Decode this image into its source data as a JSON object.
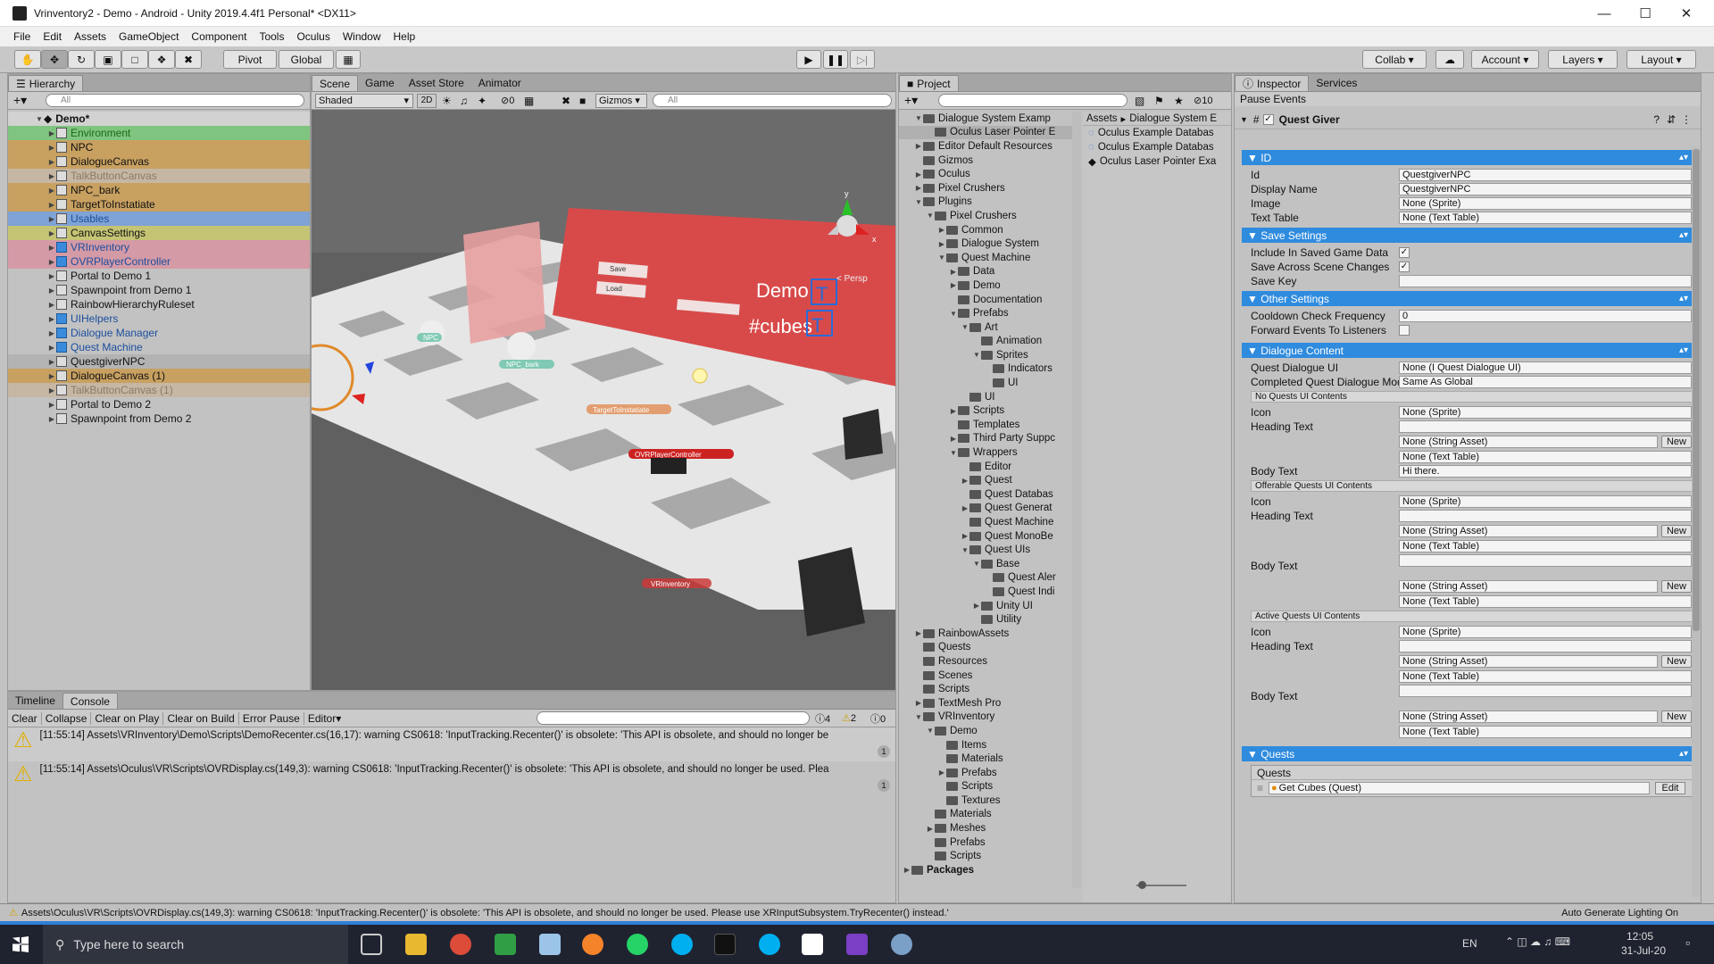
{
  "window": {
    "title": "Vrinventory2 - Demo - Android - Unity 2019.4.4f1 Personal* <DX11>"
  },
  "menu": [
    "File",
    "Edit",
    "Assets",
    "GameObject",
    "Component",
    "Tools",
    "Oculus",
    "Window",
    "Help"
  ],
  "toolbar": {
    "pivot": "Pivot",
    "global": "Global",
    "collab": "Collab",
    "account": "Account",
    "layers": "Layers",
    "layout": "Layout"
  },
  "hierarchy": {
    "tab": "Hierarchy",
    "search_placeholder": "All",
    "scene": "Demo*",
    "items": [
      {
        "label": "Environment",
        "color": "#1a6b1a",
        "bg": "#7fc47f",
        "icon": "gray"
      },
      {
        "label": "NPC",
        "color": "#111",
        "bg": "#c8a060",
        "icon": "gray"
      },
      {
        "label": "DialogueCanvas",
        "color": "#111",
        "bg": "#c8a060",
        "icon": "gray"
      },
      {
        "label": "TalkButtonCanvas",
        "color": "#8a7a66",
        "bg": "#c6b7a4",
        "icon": "gray"
      },
      {
        "label": "NPC_bark",
        "color": "#111",
        "bg": "#c8a060",
        "icon": "gray"
      },
      {
        "label": "TargetToInstatiate",
        "color": "#111",
        "bg": "#c8a060",
        "icon": "gray"
      },
      {
        "label": "Usables",
        "color": "#1c4e9e",
        "bg": "#7fa3d6",
        "icon": "gray"
      },
      {
        "label": "CanvasSettings",
        "color": "#111",
        "bg": "#c4c474",
        "icon": "gray"
      },
      {
        "label": "VRInventory",
        "color": "#1c4e9e",
        "bg": "#d49aa6",
        "icon": "blue"
      },
      {
        "label": "OVRPlayerController",
        "color": "#1c4e9e",
        "bg": "#d49aa6",
        "icon": "blue"
      },
      {
        "label": "Portal to Demo 1",
        "color": "#111",
        "bg": "",
        "icon": "gray"
      },
      {
        "label": "Spawnpoint from Demo 1",
        "color": "#111",
        "bg": "",
        "icon": "gray"
      },
      {
        "label": "RainbowHierarchyRuleset",
        "color": "#111",
        "bg": "",
        "icon": "gray"
      },
      {
        "label": "UIHelpers",
        "color": "#1c4e9e",
        "bg": "",
        "icon": "blue"
      },
      {
        "label": "Dialogue Manager",
        "color": "#1c4e9e",
        "bg": "",
        "icon": "blue"
      },
      {
        "label": "Quest Machine",
        "color": "#1c4e9e",
        "bg": "",
        "icon": "blue"
      },
      {
        "label": "QuestgiverNPC",
        "color": "#111",
        "bg": "#c8a060",
        "icon": "gray"
      },
      {
        "label": "DialogueCanvas (1)",
        "color": "#111",
        "bg": "#c8a060",
        "icon": "gray"
      },
      {
        "label": "TalkButtonCanvas (1)",
        "color": "#8a7a66",
        "bg": "#c6b7a4",
        "icon": "gray"
      },
      {
        "label": "Portal to Demo 2",
        "color": "#111",
        "bg": "",
        "icon": "gray"
      },
      {
        "label": "Spawnpoint from Demo 2",
        "color": "#111",
        "bg": "",
        "icon": "gray"
      }
    ]
  },
  "scene": {
    "tabs": [
      "Scene",
      "Game",
      "Asset Store",
      "Animator"
    ],
    "shading": "Shaded",
    "mode2d": "2D",
    "gizmos": "Gizmos",
    "search_placeholder": "All",
    "persp": "< Persp",
    "hidden_count": "0",
    "labels": {
      "npc": "NPC",
      "npc_bark": "NPC_bark",
      "target": "TargetToInstatiate",
      "ovr": "OVRPlayerController",
      "vrinv": "VRInventory",
      "demo": "Demo",
      "cubes": "#cubes",
      "t1": "T",
      "t2": "T",
      "save": "Save",
      "load": "Load"
    }
  },
  "console": {
    "tabs": [
      "Timeline",
      "Console"
    ],
    "buttons": [
      "Clear",
      "Collapse",
      "Clear on Play",
      "Clear on Build",
      "Error Pause",
      "Editor"
    ],
    "counts": {
      "info": "4",
      "warn": "2",
      "err": "0"
    },
    "messages": [
      {
        "text": "[11:55:14] Assets\\VRInventory\\Demo\\Scripts\\DemoRecenter.cs(16,17): warning CS0618: 'InputTracking.Recenter()' is obsolete: 'This API is obsolete, and should no longer be",
        "count": "1"
      },
      {
        "text": "[11:55:14] Assets\\Oculus\\VR\\Scripts\\OVRDisplay.cs(149,3): warning CS0618: 'InputTracking.Recenter()' is obsolete: 'This API is obsolete, and should no longer be used. Plea",
        "count": "1"
      }
    ]
  },
  "project": {
    "tab": "Project",
    "hidden_count": "10",
    "tree": [
      {
        "label": "Dialogue System Examp",
        "d": 1,
        "a": "▼"
      },
      {
        "label": "Oculus Laser Pointer E",
        "d": 2,
        "a": ""
      },
      {
        "label": "Editor Default Resources",
        "d": 1,
        "a": "▶"
      },
      {
        "label": "Gizmos",
        "d": 1,
        "a": ""
      },
      {
        "label": "Oculus",
        "d": 1,
        "a": "▶"
      },
      {
        "label": "Pixel Crushers",
        "d": 1,
        "a": "▶"
      },
      {
        "label": "Plugins",
        "d": 1,
        "a": "▼"
      },
      {
        "label": "Pixel Crushers",
        "d": 2,
        "a": "▼"
      },
      {
        "label": "Common",
        "d": 3,
        "a": "▶"
      },
      {
        "label": "Dialogue System",
        "d": 3,
        "a": "▶"
      },
      {
        "label": "Quest Machine",
        "d": 3,
        "a": "▼"
      },
      {
        "label": "Data",
        "d": 4,
        "a": "▶"
      },
      {
        "label": "Demo",
        "d": 4,
        "a": "▶"
      },
      {
        "label": "Documentation",
        "d": 4,
        "a": ""
      },
      {
        "label": "Prefabs",
        "d": 4,
        "a": "▼"
      },
      {
        "label": "Art",
        "d": 5,
        "a": "▼"
      },
      {
        "label": "Animation",
        "d": 6,
        "a": ""
      },
      {
        "label": "Sprites",
        "d": 6,
        "a": "▼"
      },
      {
        "label": "Indicators",
        "d": 7,
        "a": ""
      },
      {
        "label": "UI",
        "d": 7,
        "a": ""
      },
      {
        "label": "UI",
        "d": 5,
        "a": ""
      },
      {
        "label": "Scripts",
        "d": 4,
        "a": "▶"
      },
      {
        "label": "Templates",
        "d": 4,
        "a": ""
      },
      {
        "label": "Third Party Suppc",
        "d": 4,
        "a": "▶"
      },
      {
        "label": "Wrappers",
        "d": 4,
        "a": "▼"
      },
      {
        "label": "Editor",
        "d": 5,
        "a": ""
      },
      {
        "label": "Quest",
        "d": 5,
        "a": "▶"
      },
      {
        "label": "Quest Databas",
        "d": 5,
        "a": ""
      },
      {
        "label": "Quest Generat",
        "d": 5,
        "a": "▶"
      },
      {
        "label": "Quest Machine",
        "d": 5,
        "a": ""
      },
      {
        "label": "Quest MonoBe",
        "d": 5,
        "a": "▶"
      },
      {
        "label": "Quest UIs",
        "d": 5,
        "a": "▼"
      },
      {
        "label": "Base",
        "d": 6,
        "a": "▼"
      },
      {
        "label": "Quest Aler",
        "d": 7,
        "a": ""
      },
      {
        "label": "Quest Indi",
        "d": 7,
        "a": ""
      },
      {
        "label": "Unity UI",
        "d": 6,
        "a": "▶"
      },
      {
        "label": "Utility",
        "d": 6,
        "a": ""
      },
      {
        "label": "RainbowAssets",
        "d": 1,
        "a": "▶"
      },
      {
        "label": "Quests",
        "d": 1,
        "a": ""
      },
      {
        "label": "Resources",
        "d": 1,
        "a": ""
      },
      {
        "label": "Scenes",
        "d": 1,
        "a": ""
      },
      {
        "label": "Scripts",
        "d": 1,
        "a": ""
      },
      {
        "label": "TextMesh Pro",
        "d": 1,
        "a": "▶"
      },
      {
        "label": "VRInventory",
        "d": 1,
        "a": "▼"
      },
      {
        "label": "Demo",
        "d": 2,
        "a": "▼"
      },
      {
        "label": "Items",
        "d": 3,
        "a": ""
      },
      {
        "label": "Materials",
        "d": 3,
        "a": ""
      },
      {
        "label": "Prefabs",
        "d": 3,
        "a": "▶"
      },
      {
        "label": "Scripts",
        "d": 3,
        "a": ""
      },
      {
        "label": "Textures",
        "d": 3,
        "a": ""
      },
      {
        "label": "Materials",
        "d": 2,
        "a": ""
      },
      {
        "label": "Meshes",
        "d": 2,
        "a": "▶"
      },
      {
        "label": "Prefabs",
        "d": 2,
        "a": ""
      },
      {
        "label": "Scripts",
        "d": 2,
        "a": ""
      },
      {
        "label": "Packages",
        "d": 0,
        "a": "▶"
      }
    ],
    "breadcrumb": [
      "Assets",
      "Dialogue System E"
    ],
    "assets": [
      "Oculus Example Databas",
      "Oculus Example Databas",
      "Oculus Laser Pointer Exa"
    ]
  },
  "inspector": {
    "tabs": [
      "Inspector",
      "Services"
    ],
    "pause_events": "Pause Events",
    "component": "Quest Giver",
    "sections": {
      "id": "ID",
      "save": "Save Settings",
      "other": "Other Settings",
      "dialogue": "Dialogue Content",
      "quests": "Quests"
    },
    "id_fields": [
      {
        "l": "Id",
        "v": "QuestgiverNPC"
      },
      {
        "l": "Display Name",
        "v": "QuestgiverNPC"
      },
      {
        "l": "Image",
        "v": "None (Sprite)"
      },
      {
        "l": "Text Table",
        "v": "None (Text Table)"
      }
    ],
    "save_fields": {
      "include": "Include In Saved Game Data",
      "across": "Save Across Scene Changes",
      "key": "Save Key"
    },
    "other_fields": {
      "cooldown": "Cooldown Check Frequency",
      "cooldown_v": "0",
      "forward": "Forward Events To Listeners"
    },
    "dialogue_fields": {
      "qdui": "Quest Dialogue UI",
      "qdui_v": "None (I Quest Dialogue UI)",
      "mode": "Completed Quest Dialogue Mode",
      "mode_v": "Same As Global"
    },
    "groups": [
      {
        "title": "No Quests UI Contents",
        "body": "Hi there."
      },
      {
        "title": "Offerable Quests UI Contents",
        "body": ""
      },
      {
        "title": "Active Quests UI Contents",
        "body": ""
      }
    ],
    "labels": {
      "icon": "Icon",
      "heading": "Heading Text",
      "body": "Body Text",
      "none_sprite": "None (Sprite)",
      "none_string": "None (String Asset)",
      "none_table": "None (Text Table)",
      "new": "New"
    },
    "quests_label": "Quests",
    "quest_item": "Get Cubes (Quest)",
    "edit": "Edit"
  },
  "status": {
    "text": "Assets\\Oculus\\VR\\Scripts\\OVRDisplay.cs(149,3): warning CS0618: 'InputTracking.Recenter()' is obsolete: 'This API is obsolete, and should no longer be used. Please use XRInputSubsystem.TryRecenter() instead.'",
    "right": "Auto Generate Lighting On"
  },
  "taskbar": {
    "search": "Type here to search",
    "lang": "EN",
    "time": "12:05",
    "date": "31-Jul-20"
  }
}
